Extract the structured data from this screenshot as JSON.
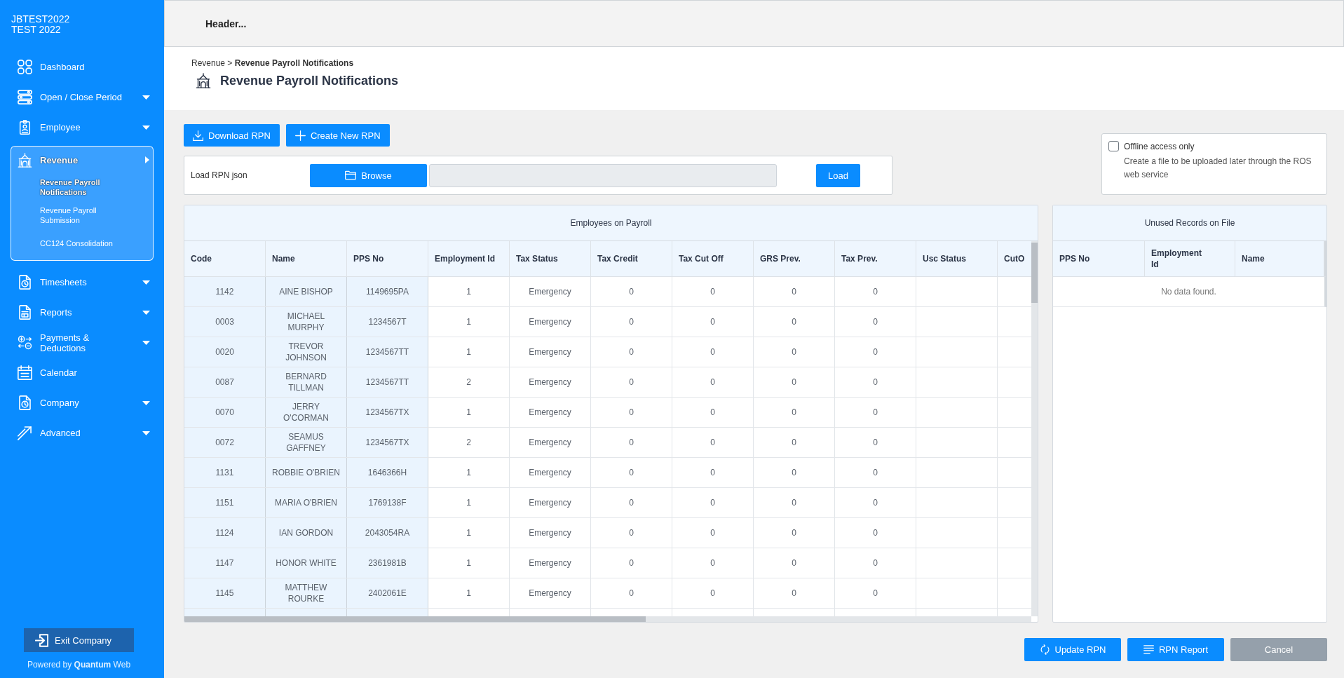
{
  "sidebar": {
    "company": {
      "code": "JBTEST2022",
      "name": "TEST 2022"
    },
    "items": [
      {
        "label": "Dashboard",
        "submenu": false,
        "expanded": false,
        "selected": false
      },
      {
        "label": "Open / Close Period",
        "submenu": true,
        "expanded": false,
        "selected": false
      },
      {
        "label": "Employee",
        "submenu": true,
        "expanded": false,
        "selected": false
      },
      {
        "label": "Revenue",
        "submenu": true,
        "expanded": true,
        "selected": true,
        "children": [
          {
            "label": "Revenue Payroll Notifications",
            "selected": true
          },
          {
            "label": "Revenue Payroll Submission",
            "selected": false
          },
          {
            "label": "CC124 Consolidation",
            "selected": false
          }
        ]
      },
      {
        "label": "Timesheets",
        "submenu": true,
        "expanded": false,
        "selected": false
      },
      {
        "label": "Reports",
        "submenu": true,
        "expanded": false,
        "selected": false
      },
      {
        "label": "Payments & Deductions",
        "submenu": true,
        "expanded": false,
        "selected": false
      },
      {
        "label": "Calendar",
        "submenu": false,
        "expanded": false,
        "selected": false
      },
      {
        "label": "Company",
        "submenu": true,
        "expanded": false,
        "selected": false
      },
      {
        "label": "Advanced",
        "submenu": true,
        "expanded": false,
        "selected": false
      }
    ],
    "exit_button": "Exit Company",
    "powered_by": "Powered by **Quantum** Web"
  },
  "header": {
    "text": "Header..."
  },
  "page": {
    "breadcrumb": "Revenue > **Revenue Payroll Notifications**",
    "title": "Revenue Payroll Notifications"
  },
  "actions": [
    "Download RPN",
    "Create New RPN"
  ],
  "load_panel": {
    "label": "Load RPN json",
    "browse_button": "Browse",
    "load_button": "Load"
  },
  "offline": {
    "label": "Offline access only",
    "checked": false,
    "description": "Create a file to be uploaded later through the ROS web service"
  },
  "employees_table": {
    "title": "Employees on Payroll",
    "frozen_columns": [
      "Code",
      "Name",
      "PPS No"
    ],
    "columns": [
      "Employment Id",
      "Tax Status",
      "Tax Credit",
      "Tax Cut Off",
      "GRS Prev.",
      "Tax Prev.",
      "Usc Status",
      "CutO"
    ],
    "rows": [
      {
        "frozen_cells": [
          "1142",
          "AINE BISHOP",
          "1149695PA"
        ],
        "cells": [
          "1",
          "Emergency",
          "0",
          "0",
          "0",
          "0"
        ]
      },
      {
        "frozen_cells": [
          "0003",
          "MICHAEL MURPHY",
          "1234567T"
        ],
        "cells": [
          "1",
          "Emergency",
          "0",
          "0",
          "0",
          "0"
        ]
      },
      {
        "frozen_cells": [
          "0020",
          "TREVOR JOHNSON",
          "1234567TT"
        ],
        "cells": [
          "1",
          "Emergency",
          "0",
          "0",
          "0",
          "0"
        ]
      },
      {
        "frozen_cells": [
          "0087",
          "BERNARD TILLMAN",
          "1234567TT"
        ],
        "cells": [
          "2",
          "Emergency",
          "0",
          "0",
          "0",
          "0"
        ]
      },
      {
        "frozen_cells": [
          "0070",
          "JERRY O'CORMAN",
          "1234567TX"
        ],
        "cells": [
          "1",
          "Emergency",
          "0",
          "0",
          "0",
          "0"
        ]
      },
      {
        "frozen_cells": [
          "0072",
          "SEAMUS GAFFNEY",
          "1234567TX"
        ],
        "cells": [
          "2",
          "Emergency",
          "0",
          "0",
          "0",
          "0"
        ]
      },
      {
        "frozen_cells": [
          "1131",
          "ROBBIE O'BRIEN",
          "1646366H"
        ],
        "cells": [
          "1",
          "Emergency",
          "0",
          "0",
          "0",
          "0"
        ]
      },
      {
        "frozen_cells": [
          "1151",
          "MARIA O'BRIEN",
          "1769138F"
        ],
        "cells": [
          "1",
          "Emergency",
          "0",
          "0",
          "0",
          "0"
        ]
      },
      {
        "frozen_cells": [
          "1124",
          "IAN GORDON",
          "2043054RA"
        ],
        "cells": [
          "1",
          "Emergency",
          "0",
          "0",
          "0",
          "0"
        ]
      },
      {
        "frozen_cells": [
          "1147",
          "HONOR WHITE",
          "2361981B"
        ],
        "cells": [
          "1",
          "Emergency",
          "0",
          "0",
          "0",
          "0"
        ]
      },
      {
        "frozen_cells": [
          "1145",
          "MATTHEW ROURKE",
          "2402061E"
        ],
        "cells": [
          "1",
          "Emergency",
          "0",
          "0",
          "0",
          "0"
        ]
      }
    ]
  },
  "unused_table": {
    "title": "Unused Records on File",
    "columns": [
      "PPS No",
      "Employment Id",
      "Name"
    ],
    "empty_message": "No data found."
  },
  "footer_buttons": [
    {
      "label": "Update RPN",
      "kind": "primary"
    },
    {
      "label": "RPN Report",
      "kind": "primary"
    },
    {
      "label": "Cancel",
      "kind": "secondary"
    }
  ]
}
